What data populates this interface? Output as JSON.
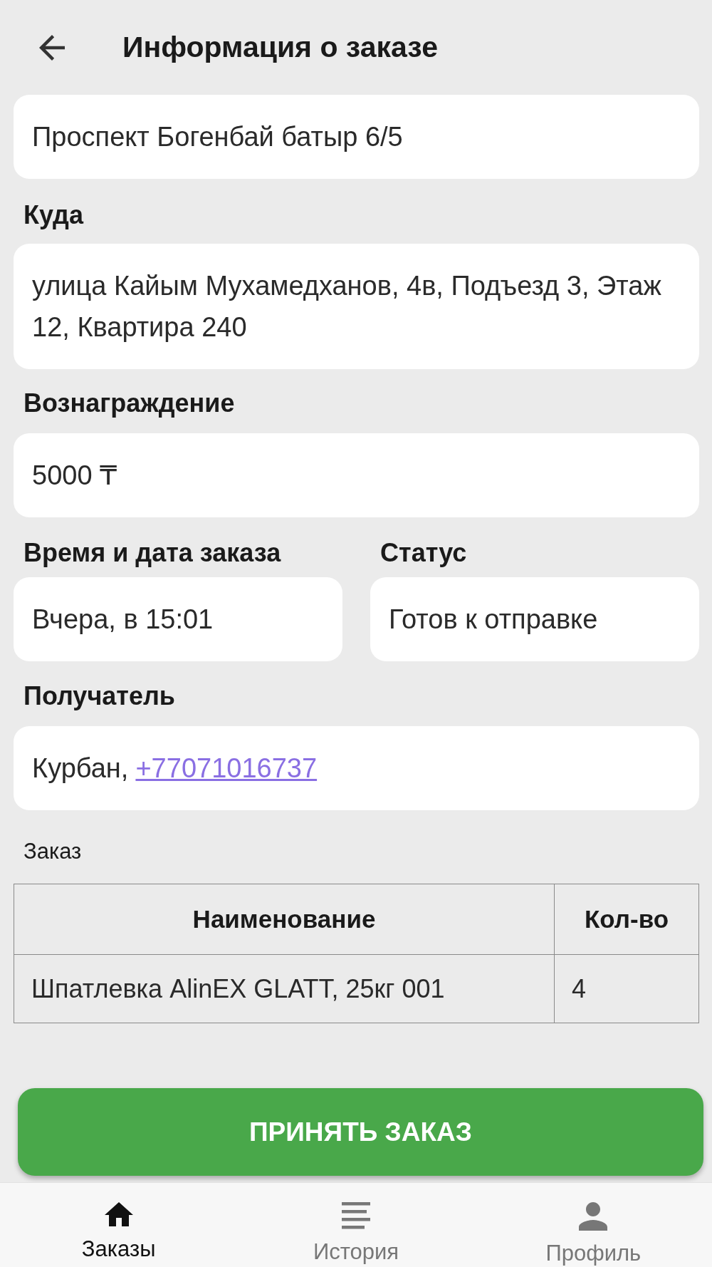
{
  "header": {
    "title": "Информация о заказе"
  },
  "pickup": {
    "value": "Проспект Богенбай батыр 6/5"
  },
  "destination": {
    "label": "Куда",
    "value": "улица Кайым Мухамедханов, 4в, Подъезд 3, Этаж 12, Квартира 240"
  },
  "reward": {
    "label": "Вознаграждение",
    "value": "5000 ₸"
  },
  "order_time": {
    "label": "Время и дата заказа",
    "value": "Вчера, в 15:01"
  },
  "status": {
    "label": "Статус",
    "value": "Готов к отправке"
  },
  "recipient": {
    "label": "Получатель",
    "name": "Курбан,",
    "phone": "+77071016737"
  },
  "order": {
    "title": "Заказ",
    "columns": [
      "Наименование",
      "Кол-во"
    ],
    "rows": [
      [
        "Шпатлевка AlinEX GLATT, 25кг 001",
        "4"
      ]
    ]
  },
  "accept_button": {
    "label": "ПРИНЯТЬ ЗАКАЗ"
  },
  "bottom_nav": {
    "items": [
      {
        "label": "Заказы",
        "selected": true
      },
      {
        "label": "История",
        "selected": false
      },
      {
        "label": "Профиль",
        "selected": false
      }
    ]
  }
}
